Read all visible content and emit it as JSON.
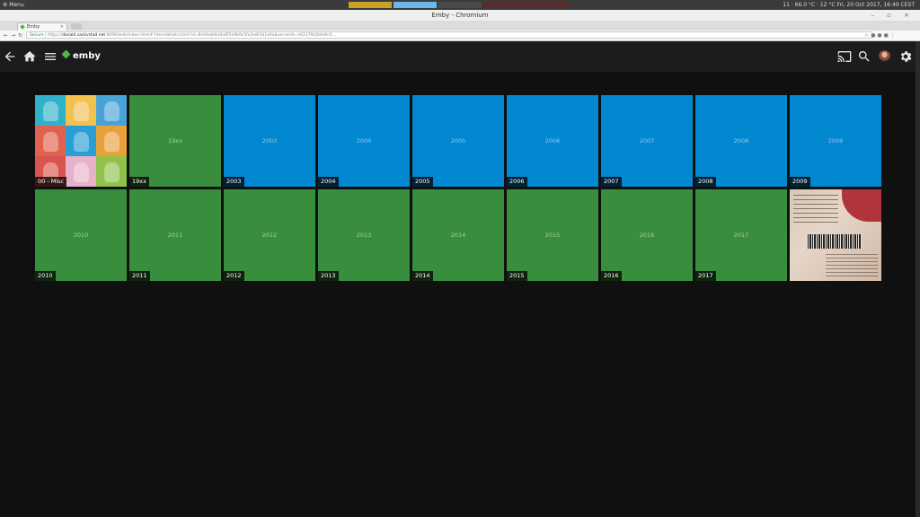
{
  "os": {
    "menu_label": "Menu",
    "tray_text": "11 · 66.0 °C · 12 °C Fri, 20 Oct 2017, 16:49 CEST"
  },
  "window": {
    "title": "Emby - Chromium",
    "tab_title": "Emby",
    "controls": "– ▫ ×"
  },
  "browser": {
    "secure_label": "Secure",
    "url_scheme": "https://",
    "url_host": "donald.sackvstad.net",
    "url_rest": ":8096/web/index.html#!/itemdetails.html?id=8c94ebf4e0a6f5e0b9c5fa3e8f3d1e6a&serverId=d42179a5bfa9c0..."
  },
  "header": {
    "logo_text": "emby"
  },
  "colors": {
    "green": "#388e3c",
    "blue": "#0288d1",
    "emby_green": "#52b54b",
    "background": "#101010"
  },
  "grid": {
    "rows": [
      [
        {
          "kind": "collage",
          "caption": "00 - Misc"
        },
        {
          "kind": "green",
          "center": "19xx",
          "caption": "19xx"
        },
        {
          "kind": "blue",
          "center": "2003",
          "caption": "2003"
        },
        {
          "kind": "blue",
          "center": "2004",
          "caption": "2004"
        },
        {
          "kind": "blue",
          "center": "2005",
          "caption": "2005"
        },
        {
          "kind": "blue",
          "center": "2006",
          "caption": "2006"
        },
        {
          "kind": "blue",
          "center": "2007",
          "caption": "2007"
        },
        {
          "kind": "blue",
          "center": "2008",
          "caption": "2008"
        },
        {
          "kind": "blue",
          "center": "2009",
          "caption": "2009"
        }
      ],
      [
        {
          "kind": "green",
          "center": "2010",
          "caption": "2010"
        },
        {
          "kind": "green",
          "center": "2011",
          "caption": "2011"
        },
        {
          "kind": "green",
          "center": "2012",
          "caption": "2012"
        },
        {
          "kind": "green",
          "center": "2013",
          "caption": "2013"
        },
        {
          "kind": "green",
          "center": "2014",
          "caption": "2014"
        },
        {
          "kind": "green",
          "center": "2015",
          "caption": "2015"
        },
        {
          "kind": "green",
          "center": "2016",
          "caption": "2016"
        },
        {
          "kind": "green",
          "center": "2017",
          "caption": "2017"
        },
        {
          "kind": "photo",
          "caption": ""
        }
      ]
    ]
  },
  "collage_colors": [
    "#2fb2c9",
    "#f2c14e",
    "#4aa3d8",
    "#e0614d",
    "#2a9ed6",
    "#e9a23b",
    "#d9534f",
    "#e7b2c9",
    "#8fc24a"
  ]
}
